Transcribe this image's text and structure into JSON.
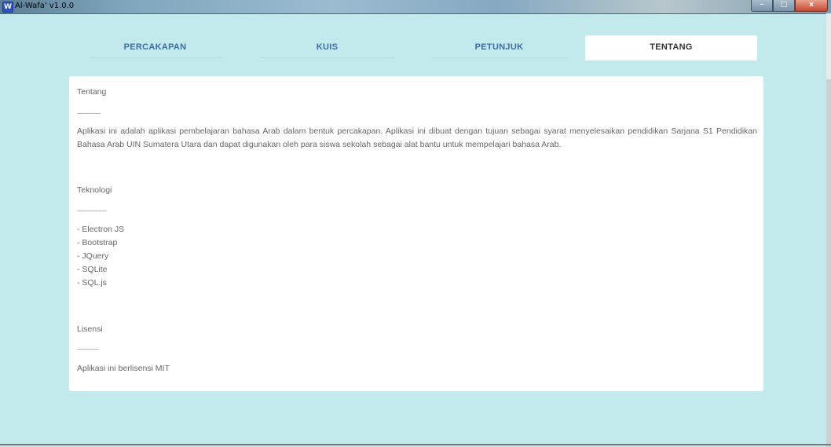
{
  "window": {
    "app_icon_letter": "W",
    "title": "Al-Wafa' v1.0.0",
    "controls": {
      "minimize": "–",
      "maximize": "□",
      "close": "x"
    }
  },
  "nav": {
    "tabs": [
      {
        "label": "PERCAKAPAN",
        "active": false
      },
      {
        "label": "KUIS",
        "active": false
      },
      {
        "label": "PETUNJUK",
        "active": false
      },
      {
        "label": "TENTANG",
        "active": true
      }
    ]
  },
  "about": {
    "heading": "Tentang",
    "heading_rule": "------------",
    "description": "Aplikasi ini adalah aplikasi pembelajaran bahasa Arab dalam bentuk percakapan. Aplikasi ini dibuat dengan tujuan sebagai syarat menyelesaikan pendidikan Sarjana S1 Pendidikan Bahasa Arab UIN Sumatera Utara dan dapat digunakan oleh para siswa sekolah sebagai alat bantu untuk mempelajari bahasa Arab.",
    "tech_heading": "Teknologi",
    "tech_rule": "---------------",
    "technologies": [
      "- Electron JS",
      "- Bootstrap",
      "- JQuery",
      "- SQLite",
      "- SQL.js"
    ],
    "license_heading": "Lisensi",
    "license_rule": "-----------",
    "license_text": "Aplikasi ini berlisensi MIT"
  }
}
